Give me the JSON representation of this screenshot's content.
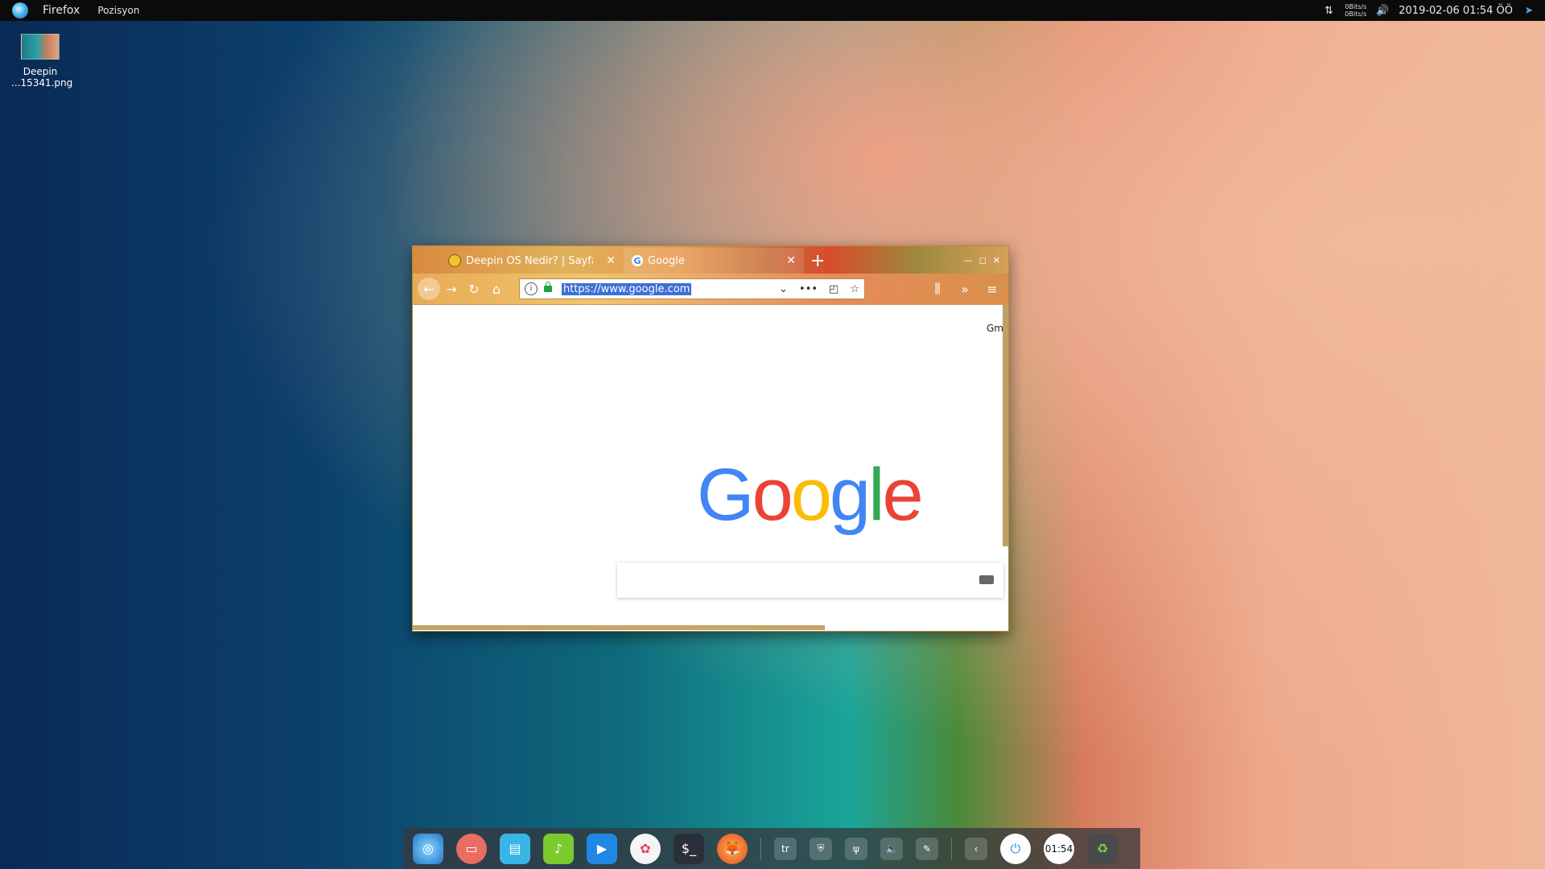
{
  "topbar": {
    "app_name": "Firefox",
    "menu_item": "Pozisyon",
    "net_up": "0Bits/s",
    "net_down": "0Bits/s",
    "clock": "2019-02-06 01:54 ÖÖ"
  },
  "desktop": {
    "file_label_line1": "Deepin",
    "file_label_line2": "...15341.png"
  },
  "browser": {
    "tabs": [
      {
        "label": "Deepin OS Nedir? | Sayfa"
      },
      {
        "label": "Google"
      }
    ],
    "url": "https://www.google.com",
    "gmail_link": "Gm"
  },
  "google": {
    "logo_letters": [
      "G",
      "o",
      "o",
      "g",
      "l",
      "e"
    ]
  },
  "dock": {
    "apps": [
      "deepin-launcher",
      "multitasking",
      "file-manager",
      "music",
      "video",
      "settings",
      "terminal",
      "firefox"
    ],
    "keyboard_layout": "tr",
    "clock_widget": "01:54"
  }
}
